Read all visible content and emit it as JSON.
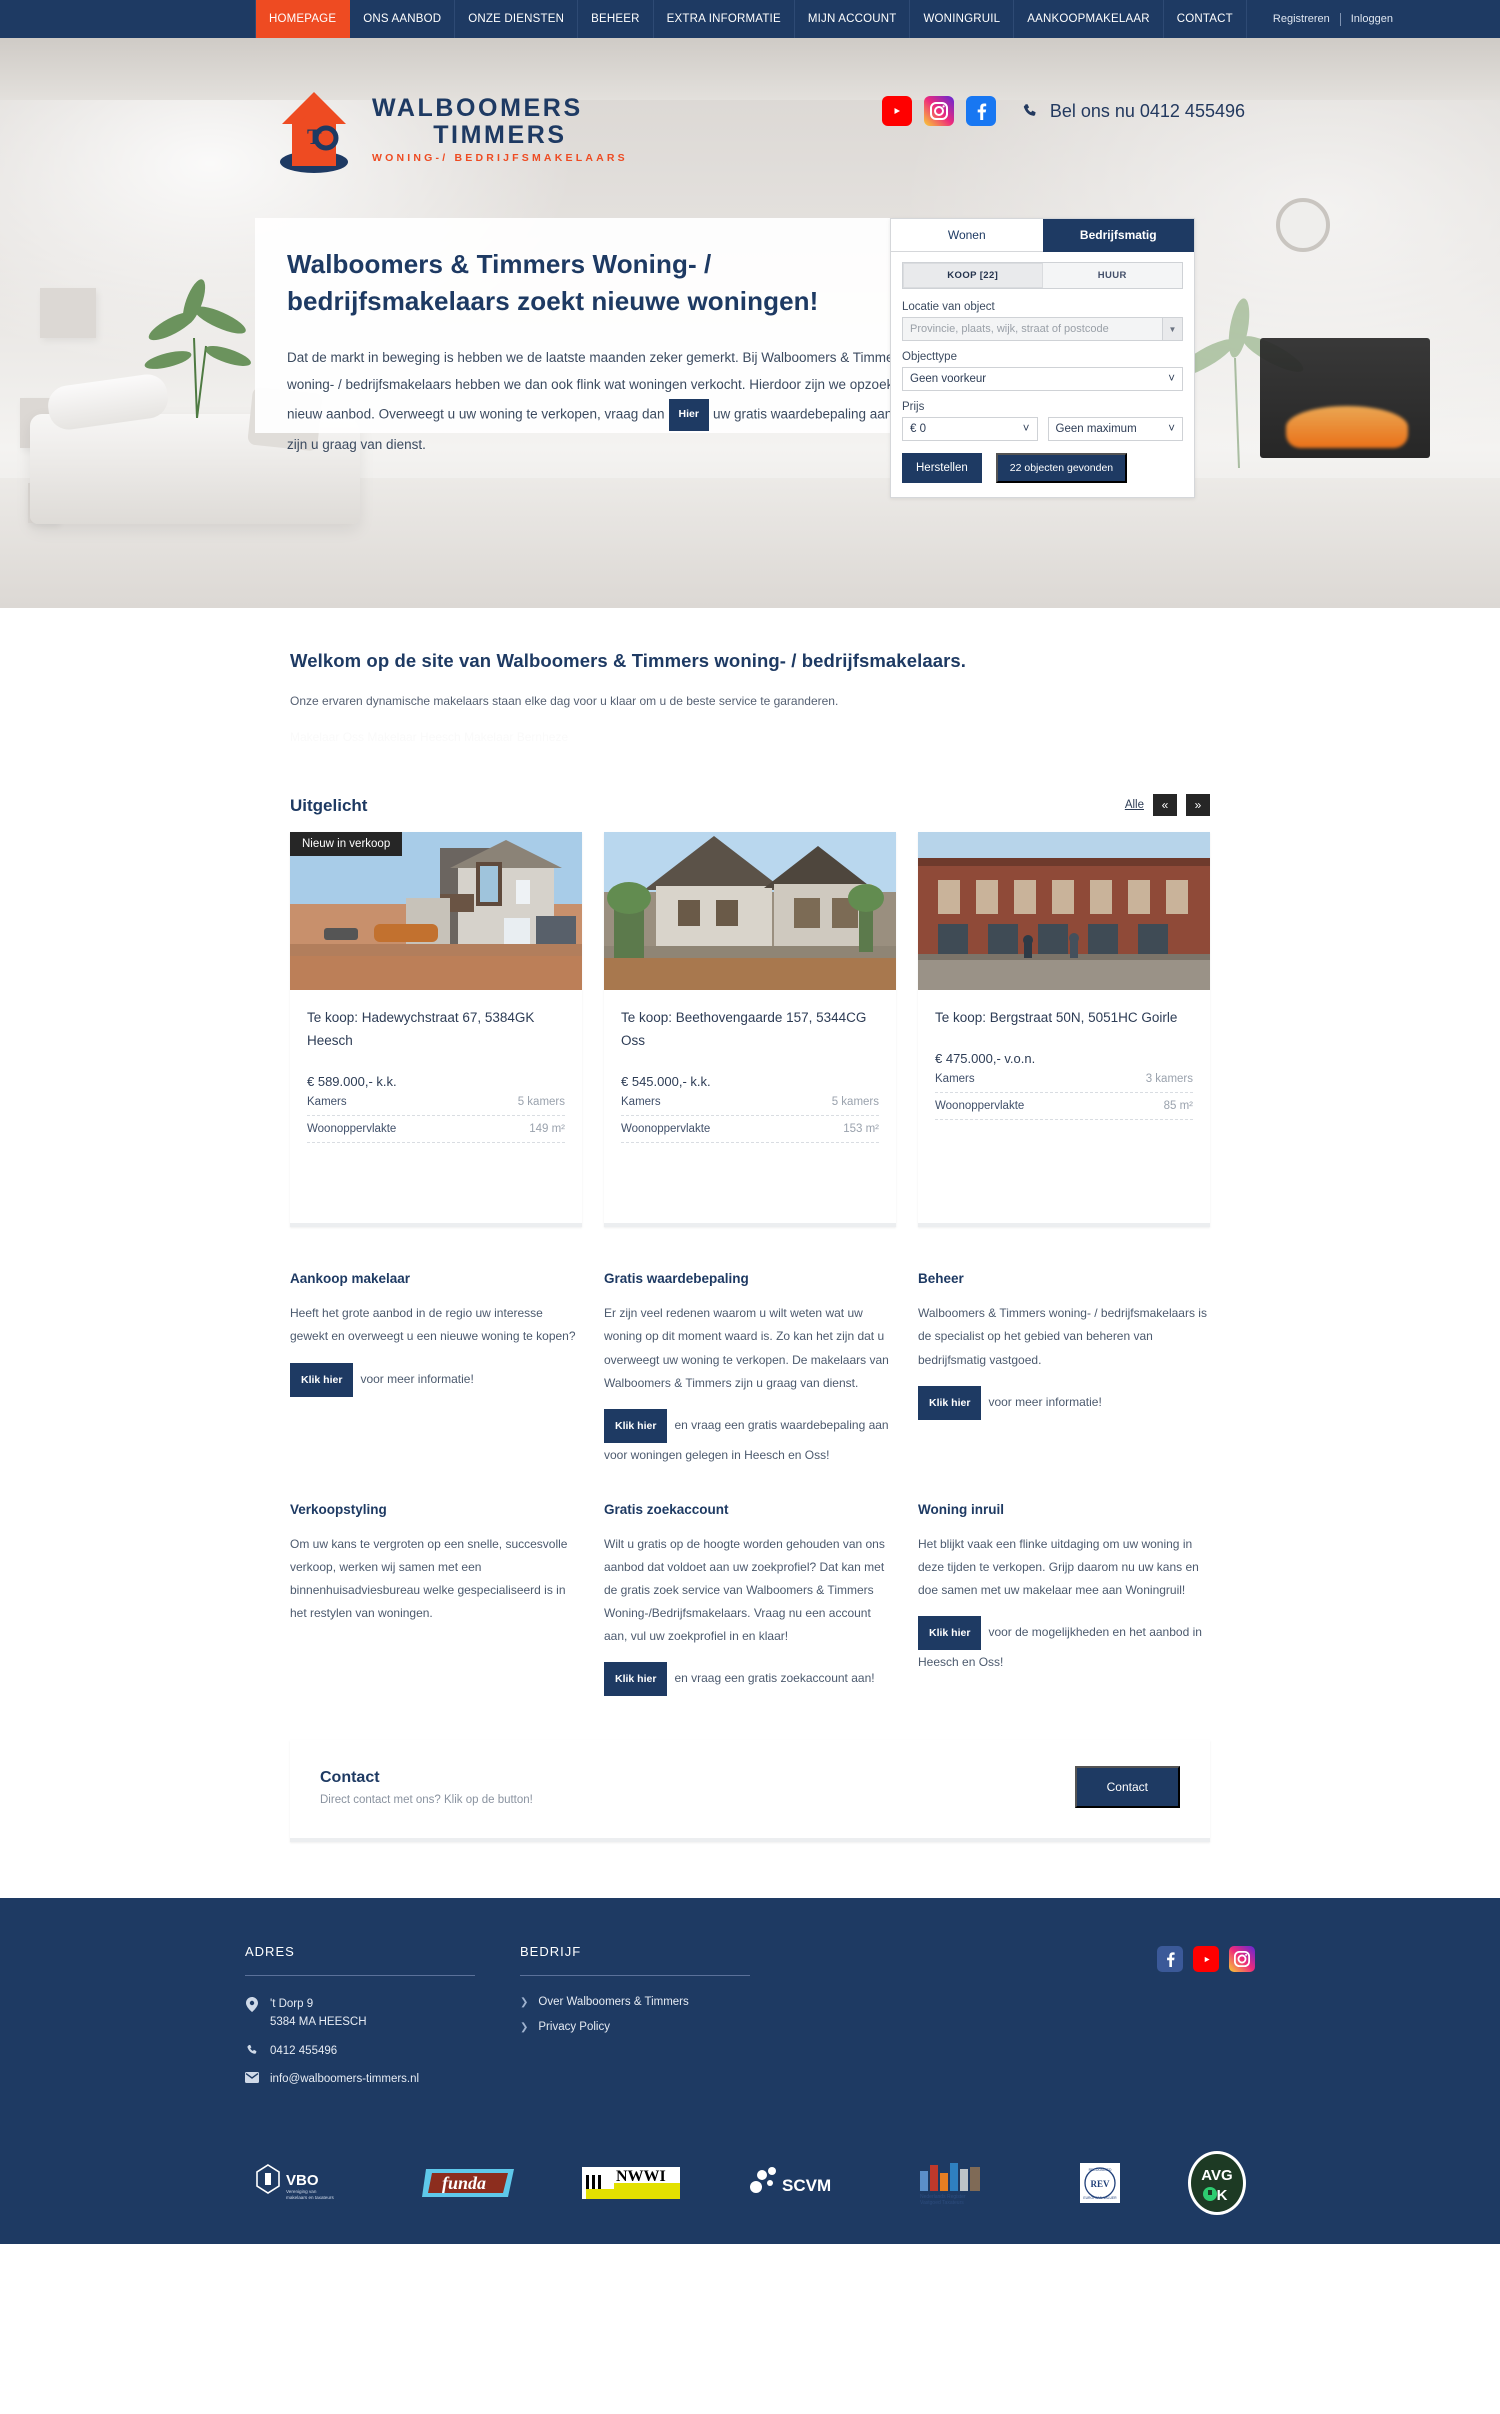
{
  "nav": {
    "items": [
      {
        "label": "HOMEPAGE",
        "active": true
      },
      {
        "label": "ONS AANBOD",
        "active": false
      },
      {
        "label": "ONZE DIENSTEN",
        "active": false
      },
      {
        "label": "BEHEER",
        "active": false
      },
      {
        "label": "EXTRA INFORMATIE",
        "active": false
      },
      {
        "label": "MIJN ACCOUNT",
        "active": false
      },
      {
        "label": "WONINGRUIL",
        "active": false
      },
      {
        "label": "AANKOOPMAKELAAR",
        "active": false
      },
      {
        "label": "CONTACT",
        "active": false
      }
    ],
    "register": "Registreren",
    "login": "Inloggen"
  },
  "header": {
    "logo_line1": "WALBOOMERS",
    "logo_line2": "TIMMERS",
    "logo_line3": "WONING-/ BEDRIJFSMAKELAARS",
    "phone_text": "Bel ons nu 0412 455496",
    "social": [
      "youtube-icon",
      "instagram-icon",
      "facebook-icon"
    ]
  },
  "hero": {
    "title": "Walboomers & Timmers Woning- / bedrijfsmakelaars zoekt nieuwe woningen!",
    "body_1": "Dat de markt in beweging is hebben we de laatste maanden zeker gemerkt. Bij Walboomers & Timmers woning- / bedrijfsmakelaars hebben we dan ook flink wat woningen verkocht. Hierdoor zijn we opzoek naar nieuw aanbod. Overweegt u uw woning te verkopen, vraag dan",
    "inline_button": "Hier",
    "body_2": "uw gratis waardebepaling aan. Wij zijn u graag van dienst."
  },
  "search": {
    "tabs": [
      {
        "label": "Wonen",
        "active": false
      },
      {
        "label": "Bedrijfsmatig",
        "active": true
      }
    ],
    "subtabs": [
      {
        "label": "KOOP [22]",
        "active": true
      },
      {
        "label": "HUUR",
        "active": false
      }
    ],
    "location_label": "Locatie van object",
    "location_placeholder": "Provincie, plaats, wijk, straat of postcode",
    "objecttype_label": "Objecttype",
    "objecttype_value": "Geen voorkeur",
    "price_label": "Prijs",
    "price_min": "€ 0",
    "price_max": "Geen maximum",
    "reset_button": "Herstellen",
    "results_button": "22 objecten gevonden"
  },
  "welcome": {
    "title": "Welkom op de site van Walboomers & Timmers woning- / bedrijfsmakelaars.",
    "lead": "Onze ervaren dynamische makelaars staan elke dag voor u klaar om u de beste service te garanderen.",
    "seo": "Makelaar Oss  Makelaar Heesch  Makelaar Bernheze"
  },
  "featured": {
    "title": "Uitgelicht",
    "all_label": "Alle",
    "prev_icon": "«",
    "next_icon": "»",
    "spec_labels": {
      "rooms": "Kamers",
      "area": "Woonoppervlakte"
    },
    "items": [
      {
        "badge": "Nieuw in verkoop",
        "title": "Te koop: Hadewychstraat 67, 5384GK Heesch",
        "price": "€ 589.000,- k.k.",
        "rooms": "5 kamers",
        "area": "149 m²"
      },
      {
        "badge": "",
        "title": "Te koop: Beethovengaarde 157, 5344CG Oss",
        "price": "€ 545.000,- k.k.",
        "rooms": "5 kamers",
        "area": "153 m²"
      },
      {
        "badge": "",
        "title": "Te koop: Bergstraat 50N, 5051HC Goirle",
        "price": "€ 475.000,- v.o.n.",
        "rooms": "3 kamers",
        "area": "85 m²"
      }
    ]
  },
  "services": [
    {
      "title": "Aankoop makelaar",
      "body": "Heeft het grote aanbod in de regio uw interesse gewekt en overweegt u een nieuwe woning te kopen?",
      "button": "Klik hier",
      "after": "voor meer informatie!"
    },
    {
      "title": "Gratis waardebepaling",
      "body": "Er zijn veel redenen waarom u wilt weten wat uw woning op dit moment waard is. Zo kan het zijn dat u overweegt uw woning te verkopen. De makelaars van Walboomers & Timmers zijn u graag van dienst.",
      "button": "Klik hier",
      "after": "en vraag een gratis waardebepaling aan voor woningen gelegen in Heesch en Oss!"
    },
    {
      "title": "Beheer",
      "body": "Walboomers & Timmers woning- / bedrijfsmakelaars is de specialist op het gebied van beheren van bedrijfsmatig vastgoed.",
      "button": "Klik hier",
      "after": "voor meer informatie!"
    },
    {
      "title": "Verkoopstyling",
      "body": "Om uw kans te vergroten op een snelle, succesvolle verkoop, werken wij samen met een binnenhuisadviesbureau welke gespecialiseerd is in het restylen van woningen.",
      "button": "",
      "after": ""
    },
    {
      "title": "Gratis zoekaccount",
      "body": "Wilt u gratis op de hoogte worden gehouden van ons aanbod dat voldoet aan uw zoekprofiel? Dat kan met de gratis zoek service van Walboomers & Timmers Woning-/Bedrijfsmakelaars. Vraag nu een account aan, vul uw zoekprofiel in en klaar!",
      "button": "Klik hier",
      "after": "en vraag een gratis zoekaccount aan!"
    },
    {
      "title": "Woning inruil",
      "body": "Het blijkt vaak een flinke uitdaging om uw woning in deze tijden te verkopen. Grijp daarom nu uw kans en doe samen met uw makelaar mee aan Woningruil!",
      "button": "Klik hier",
      "after": "voor de mogelijkheden en het aanbod in Heesch en Oss!"
    }
  ],
  "contact_strip": {
    "title": "Contact",
    "subtitle": "Direct contact met ons? Klik op de button!",
    "button": "Contact"
  },
  "footer": {
    "address_heading": "ADRES",
    "company_heading": "BEDRIJF",
    "street": "'t Dorp 9",
    "city": "5384 MA HEESCH",
    "phone": "0412 455496",
    "email": "info@walboomers-timmers.nl",
    "links": [
      "Over Walboomers & Timmers",
      "Privacy Policy"
    ],
    "social": [
      "facebook-icon",
      "youtube-icon",
      "instagram-icon"
    ],
    "partners": [
      "VBO",
      "funda",
      "NWWI",
      "SCVM",
      "Nederlands Woning Waarde Instituut",
      "REV",
      "AVG OK"
    ]
  },
  "colors": {
    "navy": "#1e3a63",
    "orange": "#ee4b22",
    "dark": "#262626"
  }
}
